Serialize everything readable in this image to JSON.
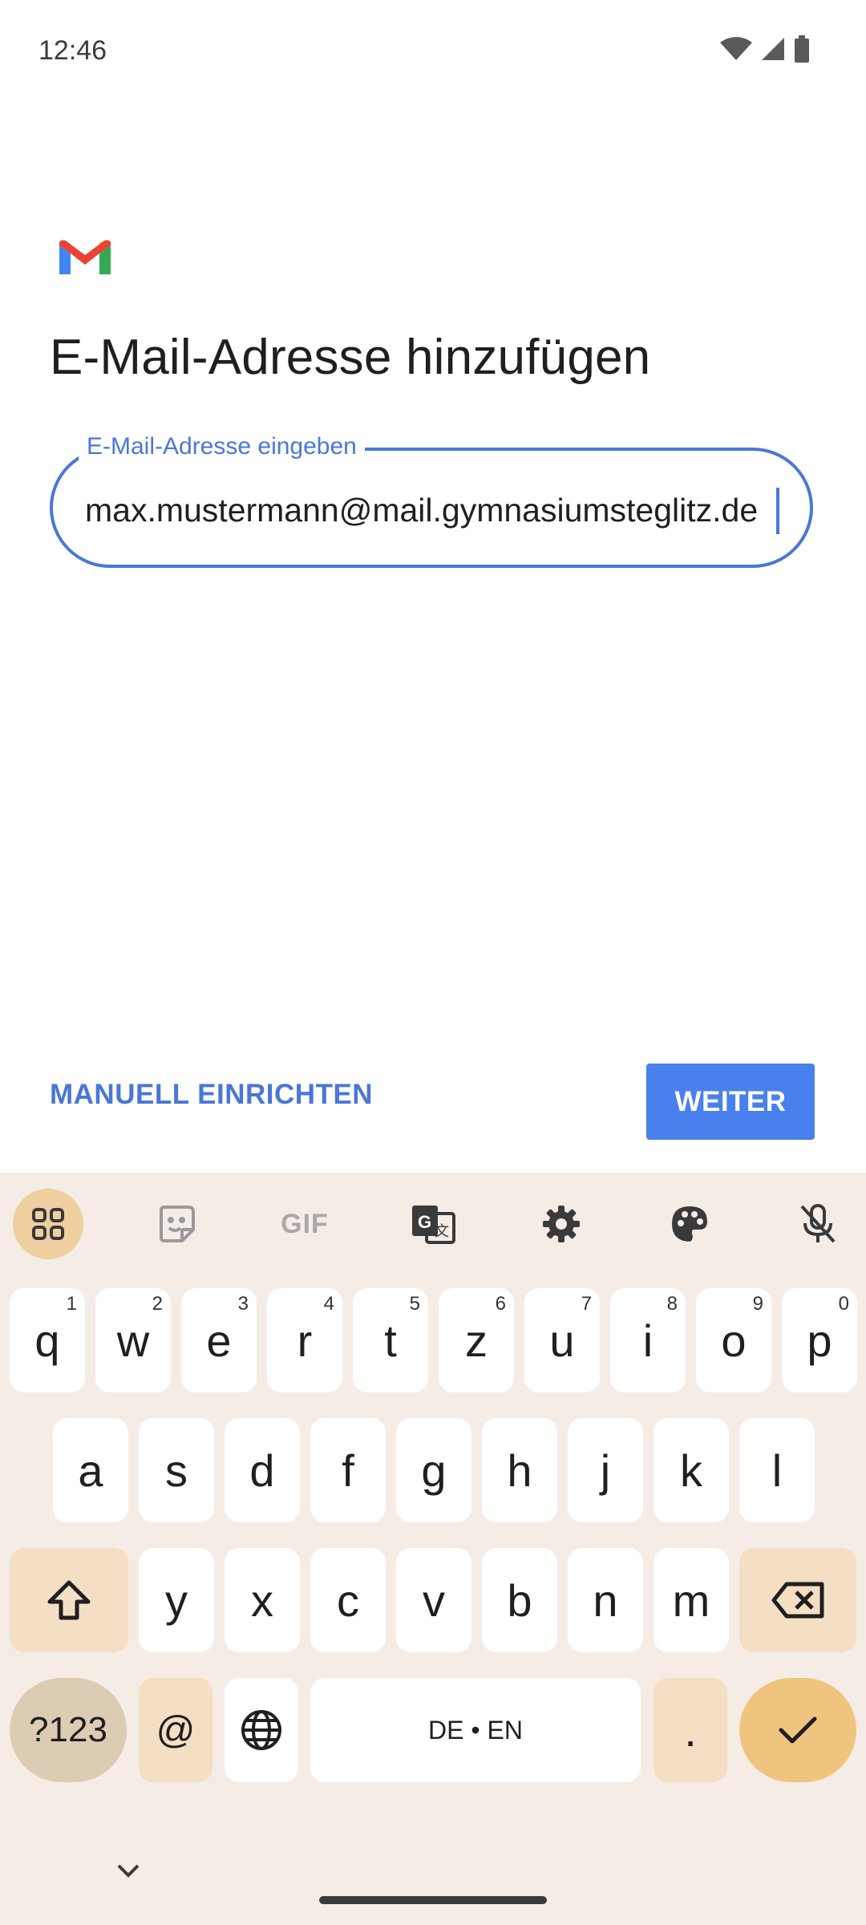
{
  "status_bar": {
    "time": "12:46",
    "icons": [
      "wifi-icon",
      "signal-icon",
      "battery-icon"
    ]
  },
  "app": {
    "logo": "gmail-logo"
  },
  "page": {
    "title": "E-Mail-Adresse hinzufügen",
    "email_field": {
      "label": "E-Mail-Adresse eingeben",
      "value": "max.mustermann@mail.gymnasiumsteglitz.de"
    },
    "actions": {
      "manual_setup": "MANUELL EINRICHTEN",
      "next": "WEITER"
    }
  },
  "keyboard": {
    "toolbar": [
      "apps-grid-icon",
      "sticker-icon",
      "gif-icon",
      "translate-icon",
      "settings-gear-icon",
      "palette-icon",
      "mic-off-icon"
    ],
    "gif_label": "GIF",
    "row1": [
      {
        "key": "q",
        "hint": "1"
      },
      {
        "key": "w",
        "hint": "2"
      },
      {
        "key": "e",
        "hint": "3"
      },
      {
        "key": "r",
        "hint": "4"
      },
      {
        "key": "t",
        "hint": "5"
      },
      {
        "key": "z",
        "hint": "6"
      },
      {
        "key": "u",
        "hint": "7"
      },
      {
        "key": "i",
        "hint": "8"
      },
      {
        "key": "o",
        "hint": "9"
      },
      {
        "key": "p",
        "hint": "0"
      }
    ],
    "row2": [
      "a",
      "s",
      "d",
      "f",
      "g",
      "h",
      "j",
      "k",
      "l"
    ],
    "row3": [
      "y",
      "x",
      "c",
      "v",
      "b",
      "n",
      "m"
    ],
    "bottom": {
      "symbols": "?123",
      "at": "@",
      "space": "DE • EN",
      "period": "."
    }
  },
  "colors": {
    "accent": "#4a76d9",
    "button": "#4a80ed",
    "keyboard_bg": "#f6ece6",
    "enter_key": "#efc47e"
  }
}
